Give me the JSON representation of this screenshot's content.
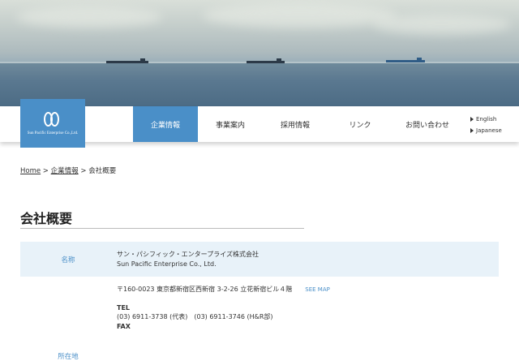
{
  "logo": {
    "text": "Sun Pacific Enterprise Co.,Ltd."
  },
  "nav": {
    "items": [
      {
        "label": "企業情報",
        "active": true
      },
      {
        "label": "事業案内"
      },
      {
        "label": "採用情報"
      },
      {
        "label": "リンク"
      },
      {
        "label": "お問い合わせ"
      }
    ],
    "lang": [
      "English",
      "Japanese"
    ]
  },
  "breadcrumb": {
    "home": "Home",
    "sep1": " > ",
    "parent": "企業情報",
    "sep2": " > ",
    "current": "会社概要"
  },
  "page_title": "会社概要",
  "table": {
    "name_label": "名称",
    "name_ja": "サン・パシフィック・エンタープライズ株式会社",
    "name_en": "Sun Pacific Enterprise Co., Ltd.",
    "address_label": "所在地",
    "address": "〒160-0023 東京都新宿区西新宿 3-2-26 立花新宿ビル４階",
    "see_map": "SEE MAP",
    "tel_label": "TEL",
    "tel_value": "(03) 6911-3738 (代表)　(03) 6911-3746 (H&R部)",
    "fax_label": "FAX"
  },
  "colors": {
    "accent": "#4a8fc8",
    "row_bg": "#e8f2f9"
  }
}
